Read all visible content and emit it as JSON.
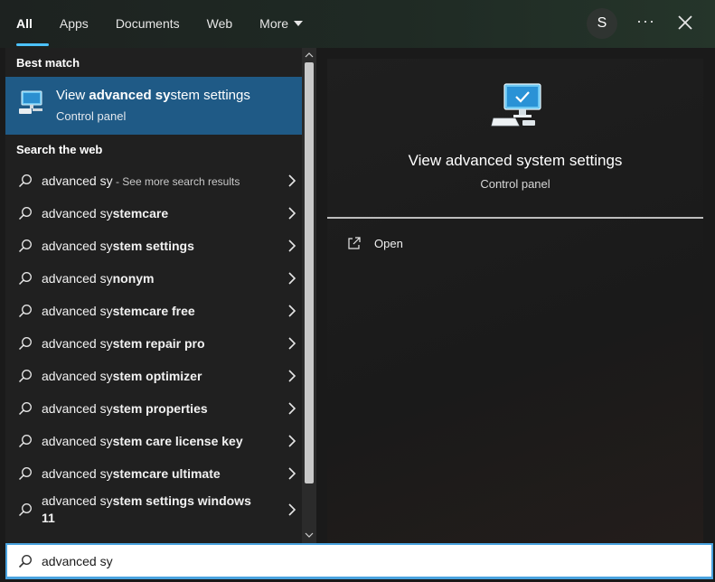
{
  "tabs": [
    {
      "label": "All",
      "active": true
    },
    {
      "label": "Apps",
      "active": false
    },
    {
      "label": "Documents",
      "active": false
    },
    {
      "label": "Web",
      "active": false
    },
    {
      "label": "More",
      "active": false
    }
  ],
  "header": {
    "avatar_letter": "S",
    "more_label": "···"
  },
  "best_match": {
    "section_label": "Best match",
    "title_pre": "View ",
    "title_bold": "advanced sy",
    "title_post": "stem settings",
    "subtitle": "Control panel",
    "icon": "computer-settings-icon"
  },
  "web": {
    "section_label": "Search the web",
    "results": [
      {
        "typed": "advanced sy",
        "rest": "",
        "hint": " - See more search results"
      },
      {
        "typed": "advanced sy",
        "rest": "stemcare",
        "hint": ""
      },
      {
        "typed": "advanced sy",
        "rest": "stem settings",
        "hint": ""
      },
      {
        "typed": "advanced sy",
        "rest": "nonym",
        "hint": ""
      },
      {
        "typed": "advanced sy",
        "rest": "stemcare free",
        "hint": ""
      },
      {
        "typed": "advanced sy",
        "rest": "stem repair pro",
        "hint": ""
      },
      {
        "typed": "advanced sy",
        "rest": "stem optimizer",
        "hint": ""
      },
      {
        "typed": "advanced sy",
        "rest": "stem properties",
        "hint": ""
      },
      {
        "typed": "advanced sy",
        "rest": "stem care license key",
        "hint": ""
      },
      {
        "typed": "advanced sy",
        "rest": "stemcare ultimate",
        "hint": ""
      },
      {
        "typed": "advanced sy",
        "rest": "stem settings windows 11",
        "hint": ""
      }
    ]
  },
  "preview": {
    "title": "View advanced system settings",
    "subtitle": "Control panel",
    "action_open": "Open"
  },
  "search": {
    "value": "advanced sy"
  },
  "colors": {
    "accent": "#4cc2ff",
    "selected_row": "#1f5a86"
  }
}
